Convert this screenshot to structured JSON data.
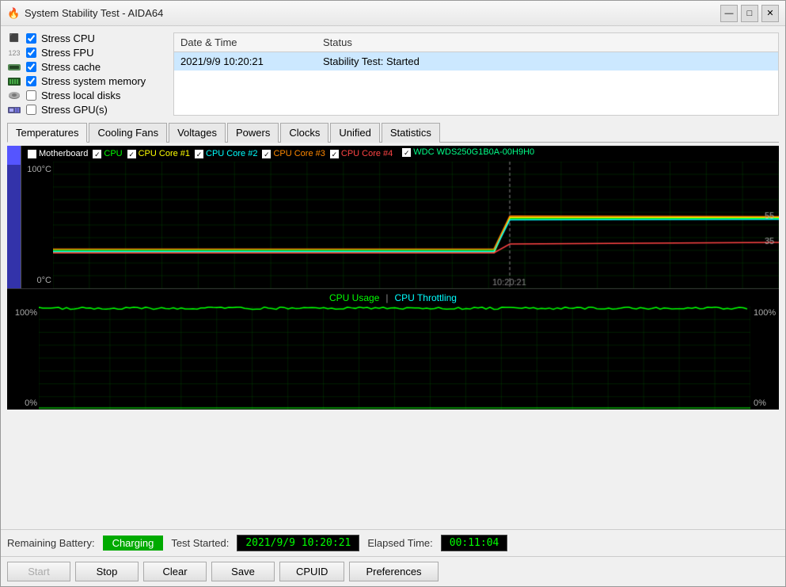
{
  "window": {
    "title": "System Stability Test - AIDA64",
    "icon": "🔥"
  },
  "titlebar": {
    "minimize": "—",
    "maximize": "□",
    "close": "✕"
  },
  "stress_options": [
    {
      "id": "stress-cpu",
      "label": "Stress CPU",
      "checked": true,
      "icon_type": "cpu"
    },
    {
      "id": "stress-fpu",
      "label": "Stress FPU",
      "checked": true,
      "icon_type": "fpu"
    },
    {
      "id": "stress-cache",
      "label": "Stress cache",
      "checked": true,
      "icon_type": "cache"
    },
    {
      "id": "stress-memory",
      "label": "Stress system memory",
      "checked": true,
      "icon_type": "memory"
    },
    {
      "id": "stress-disk",
      "label": "Stress local disks",
      "checked": false,
      "icon_type": "disk"
    },
    {
      "id": "stress-gpu",
      "label": "Stress GPU(s)",
      "checked": false,
      "icon_type": "gpu"
    }
  ],
  "log": {
    "columns": [
      "Date & Time",
      "Status"
    ],
    "rows": [
      {
        "datetime": "2021/9/9 10:20:21",
        "status": "Stability Test: Started"
      }
    ]
  },
  "tabs": [
    {
      "label": "Temperatures",
      "active": true
    },
    {
      "label": "Cooling Fans",
      "active": false
    },
    {
      "label": "Voltages",
      "active": false
    },
    {
      "label": "Powers",
      "active": false
    },
    {
      "label": "Clocks",
      "active": false
    },
    {
      "label": "Unified",
      "active": false
    },
    {
      "label": "Statistics",
      "active": false
    }
  ],
  "temp_chart": {
    "legend": [
      {
        "label": "Motherboard",
        "checked": false,
        "color": "#ffffff"
      },
      {
        "label": "CPU",
        "checked": true,
        "color": "#00ff00"
      },
      {
        "label": "CPU Core #1",
        "checked": true,
        "color": "#ffff00"
      },
      {
        "label": "CPU Core #2",
        "checked": true,
        "color": "#00ffff"
      },
      {
        "label": "CPU Core #3",
        "checked": true,
        "color": "#ff8800"
      },
      {
        "label": "CPU Core #4",
        "checked": true,
        "color": "#ff4444"
      },
      {
        "label": "WDC WDS250G1B0A-00H9H0",
        "checked": true,
        "color": "#00ff88"
      }
    ],
    "y_max": "100°C",
    "y_min": "0°C",
    "x_label": "10:20:21",
    "right_value_top": "55",
    "right_value_mid": "35",
    "grid_lines": true
  },
  "cpu_chart": {
    "legend_items": [
      {
        "label": "CPU Usage",
        "color": "#00ff00"
      },
      {
        "label": " | ",
        "color": "#888"
      },
      {
        "label": "CPU Throttling",
        "color": "#00ffff"
      }
    ],
    "y_max": "100%",
    "y_min": "0%",
    "right_top": "100%",
    "right_bottom": "0%"
  },
  "status_bar": {
    "battery_label": "Remaining Battery:",
    "battery_value": "Charging",
    "test_started_label": "Test Started:",
    "test_started_value": "2021/9/9 10:20:21",
    "elapsed_label": "Elapsed Time:",
    "elapsed_value": "00:11:04"
  },
  "buttons": [
    {
      "label": "Start",
      "disabled": true,
      "name": "start-button"
    },
    {
      "label": "Stop",
      "disabled": false,
      "name": "stop-button"
    },
    {
      "label": "Clear",
      "disabled": false,
      "name": "clear-button"
    },
    {
      "label": "Save",
      "disabled": false,
      "name": "save-button"
    },
    {
      "label": "CPUID",
      "disabled": false,
      "name": "cpuid-button"
    },
    {
      "label": "Preferences",
      "disabled": false,
      "name": "preferences-button"
    }
  ]
}
